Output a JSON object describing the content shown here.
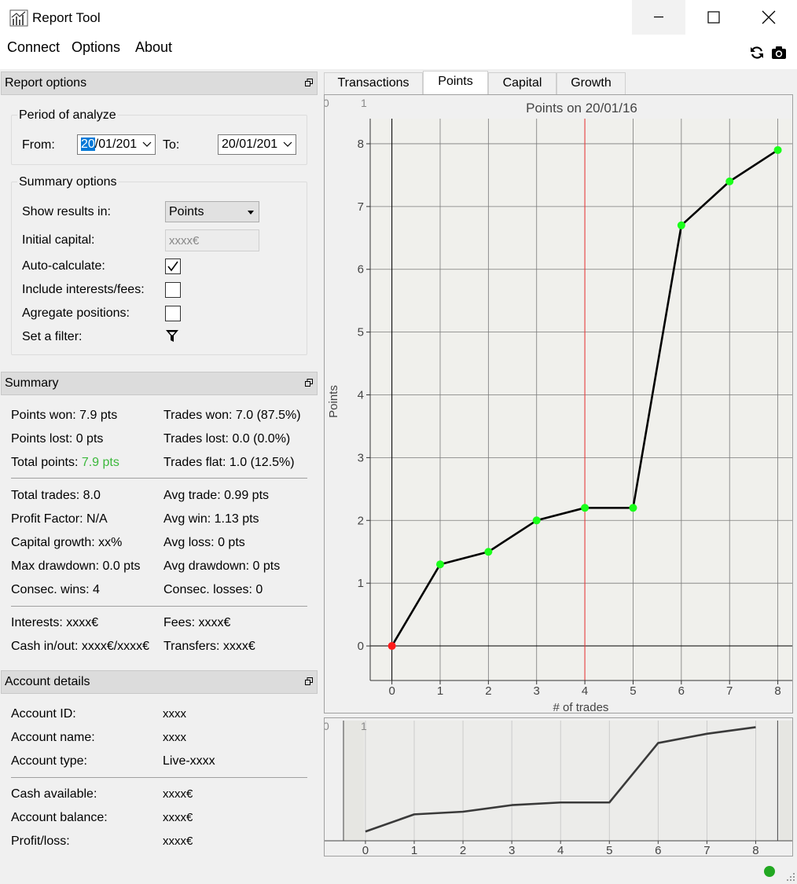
{
  "window": {
    "title": "Report Tool"
  },
  "menu": {
    "connect": "Connect",
    "options": "Options",
    "about": "About"
  },
  "report_options": {
    "header": "Report options",
    "period_group": "Period of analyze",
    "from_label": "From:",
    "from_value_selected": "20",
    "from_value_rest": "/01/201",
    "to_label": "To:",
    "to_value": "20/01/201",
    "summary_group": "Summary options",
    "show_results_label": "Show results in:",
    "show_results_value": "Points",
    "initial_capital_label": "Initial capital:",
    "initial_capital_placeholder": "xxxx€",
    "auto_calculate_label": "Auto-calculate:",
    "auto_calculate_checked": true,
    "include_fees_label": "Include interests/fees:",
    "include_fees_checked": false,
    "aggregate_label": "Agregate positions:",
    "aggregate_checked": false,
    "filter_label": "Set a filter:"
  },
  "summary": {
    "header": "Summary",
    "points_won": "Points won: 7.9 pts",
    "points_lost": "Points lost: 0 pts",
    "total_points_label": "Total points: ",
    "total_points_value": "7.9 pts",
    "total_points_color": "#3cb83c",
    "trades_won": "Trades won: 7.0 (87.5%)",
    "trades_lost": "Trades lost: 0.0 (0.0%)",
    "trades_flat": "Trades flat: 1.0 (12.5%)",
    "total_trades": "Total trades: 8.0",
    "profit_factor": "Profit Factor: N/A",
    "capital_growth": "Capital growth: xx%",
    "max_drawdown": "Max drawdown: 0.0 pts",
    "consec_wins": "Consec. wins: 4",
    "avg_trade": "Avg trade: 0.99 pts",
    "avg_win": "Avg win: 1.13 pts",
    "avg_loss": "Avg loss: 0 pts",
    "avg_drawdown": "Avg drawdown: 0 pts",
    "consec_losses": "Consec. losses: 0",
    "interests": "Interests: xxxx€",
    "cash_in_out": "Cash in/out: xxxx€/xxxx€",
    "fees": "Fees: xxxx€",
    "transfers": "Transfers: xxxx€"
  },
  "account": {
    "header": "Account details",
    "rows": [
      {
        "label": "Account ID:",
        "value": "xxxx"
      },
      {
        "label": "Account name:",
        "value": "xxxx"
      },
      {
        "label": "Account type:",
        "value": "Live-xxxx"
      },
      {
        "label": "Cash available:",
        "value": "xxxx€"
      },
      {
        "label": "Account balance:",
        "value": "xxxx€"
      },
      {
        "label": "Profit/loss:",
        "value": "xxxx€"
      }
    ]
  },
  "tabs": [
    {
      "label": "Transactions",
      "active": false
    },
    {
      "label": "Points",
      "active": true
    },
    {
      "label": "Capital",
      "active": false
    },
    {
      "label": "Growth",
      "active": false
    }
  ],
  "chart_data": {
    "type": "line",
    "title": "Points on 20/01/16",
    "xlabel": "# of trades",
    "ylabel": "Points",
    "x": [
      0,
      1,
      2,
      3,
      4,
      5,
      6,
      7,
      8
    ],
    "y": [
      0,
      1.3,
      1.5,
      2.0,
      2.2,
      2.2,
      6.7,
      7.4,
      7.9
    ],
    "xlim": [
      -0.45,
      8.3
    ],
    "ylim": [
      -0.55,
      8.4
    ],
    "xticks": [
      0,
      1,
      2,
      3,
      4,
      5,
      6,
      7,
      8
    ],
    "yticks": [
      0,
      1,
      2,
      3,
      4,
      5,
      6,
      7,
      8
    ],
    "point_colors": [
      "#ff1a1a",
      "#1aff1a",
      "#1aff1a",
      "#1aff1a",
      "#1aff1a",
      "#1aff1a",
      "#1aff1a",
      "#1aff1a",
      "#1aff1a"
    ],
    "line_color": "#000000",
    "marker_line_x": 4,
    "marker_line_color": "#ee3333",
    "grid": true,
    "corner_labels": [
      "0",
      "1"
    ]
  },
  "navigator": {
    "x": [
      0,
      1,
      2,
      3,
      4,
      5,
      6,
      7,
      8
    ],
    "y": [
      0,
      1.3,
      1.5,
      2.0,
      2.2,
      2.2,
      6.7,
      7.4,
      7.9
    ],
    "ticks": [
      0,
      1,
      2,
      3,
      4,
      5,
      6,
      7,
      8
    ],
    "corner_labels": [
      "0",
      "1"
    ]
  }
}
